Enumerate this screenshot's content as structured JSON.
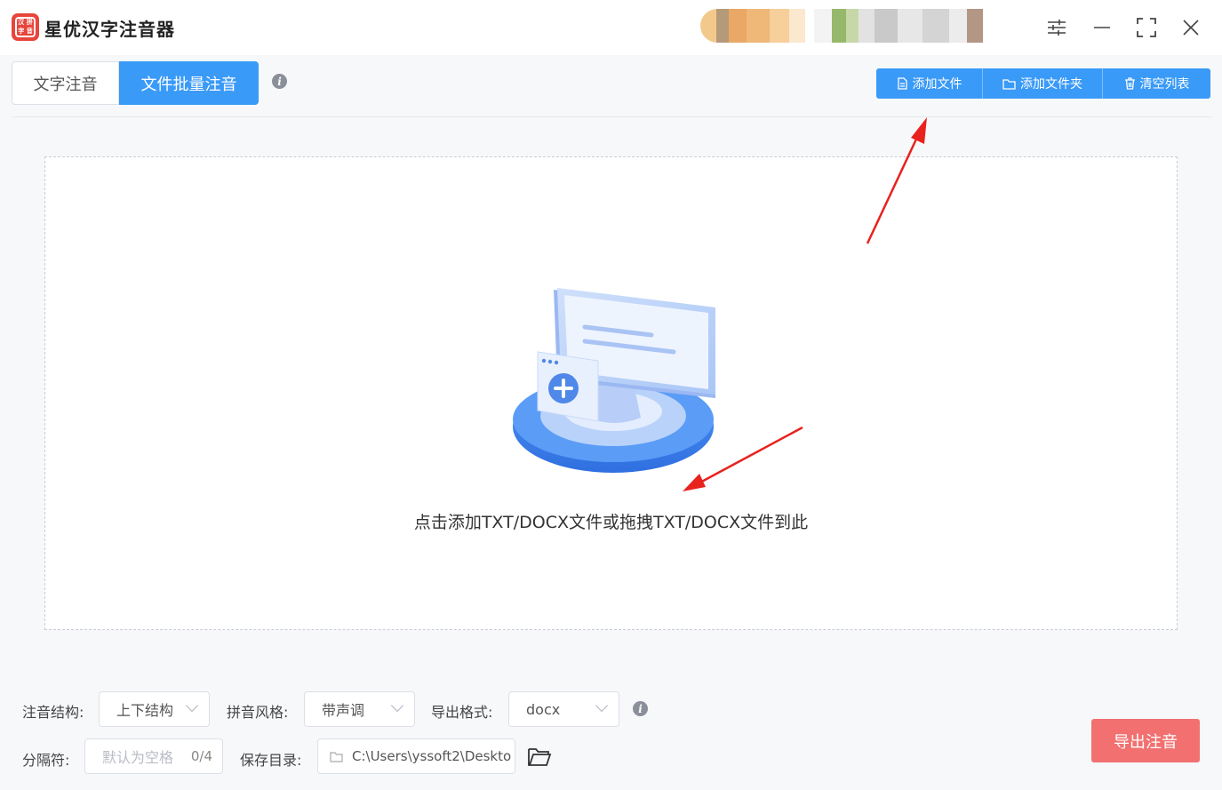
{
  "app": {
    "title": "星优汉字注音器",
    "logo_chars": [
      "汉",
      "拼",
      "字",
      "音"
    ]
  },
  "tabs": [
    {
      "label": "文字注音",
      "active": false
    },
    {
      "label": "文件批量注音",
      "active": true
    }
  ],
  "toolbar": {
    "add_file_label": "添加文件",
    "add_folder_label": "添加文件夹",
    "clear_list_label": "清空列表"
  },
  "dropzone": {
    "hint": "点击添加TXT/DOCX文件或拖拽TXT/DOCX文件到此"
  },
  "settings": {
    "structure_label": "注音结构:",
    "structure_value": "上下结构",
    "style_label": "拼音风格:",
    "style_value": "带声调",
    "format_label": "导出格式:",
    "format_value": "docx",
    "separator_label": "分隔符:",
    "separator_placeholder": "默认为空格",
    "separator_count": "0/4",
    "save_dir_label": "保存目录:",
    "save_dir_value": "C:\\Users\\yssoft2\\Deskto"
  },
  "export": {
    "label": "导出注音"
  },
  "colors": {
    "accent": "#3a9af7",
    "export": "#f27070",
    "logo": "#e8453c",
    "annotation_arrow": "#e8221d"
  }
}
